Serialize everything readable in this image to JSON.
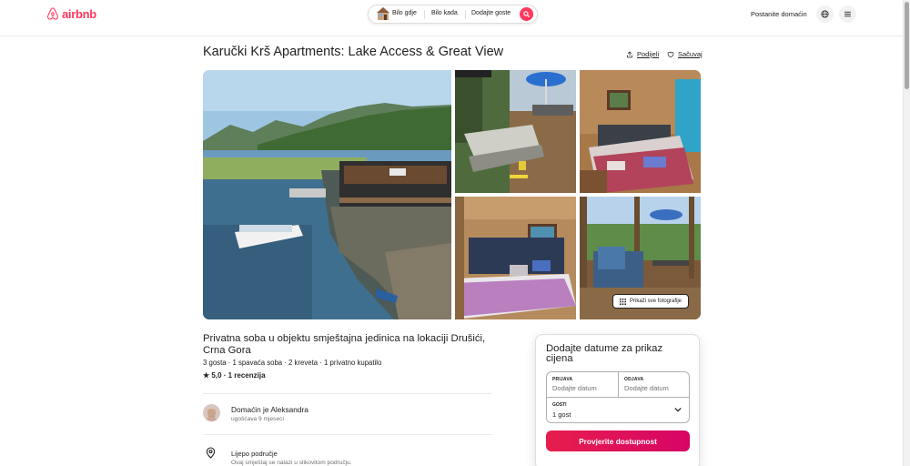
{
  "header": {
    "logo_text": "airbnb",
    "search": {
      "anywhere": "Bilo gdje",
      "anytime": "Bilo kada",
      "add_guests": "Dodajte goste"
    },
    "become_host": "Postanite domaćin"
  },
  "listing": {
    "title": "Karučki Krš Apartments: Lake Access & Great View",
    "share_label": "Podijeli",
    "save_label": "Sačuvaj",
    "show_all_photos": "Prikaži sve fotografije",
    "subtitle": "Privatna soba u objektu smještajna jedinica na lokaciji Drušići, Crna Gora",
    "facts": "3 gosta · 1 spavaća soba · 2 kreveta · 1 privatno kupatilo",
    "rating": "★ 5,0 · 1 recenzija",
    "host_name": "Domaćin je Aleksandra",
    "host_since": "ugošćava 9 mjeseci",
    "feature_title": "Lijepo područje",
    "feature_desc": "Ovaj smještaj se nalazi u slikovitom području."
  },
  "booking": {
    "title": "Dodajte datume za prikaz cijena",
    "checkin_label": "PRIJAVA",
    "checkin_value": "Dodajte datum",
    "checkout_label": "ODJAVA",
    "checkout_value": "Dodajte datum",
    "guests_label": "GOSTI",
    "guests_value": "1 gost",
    "check_button": "Provjerite dostupnost"
  },
  "colors": {
    "brand": "#ff385c",
    "button_gradient_start": "#e61e4d",
    "button_gradient_end": "#d70466"
  },
  "icons": [
    "airbnb-logo-icon",
    "house-icon",
    "search-icon",
    "share-icon",
    "heart-icon",
    "grid-icon",
    "globe-icon",
    "hamburger-icon",
    "location-pin-icon",
    "chevron-down-icon"
  ]
}
